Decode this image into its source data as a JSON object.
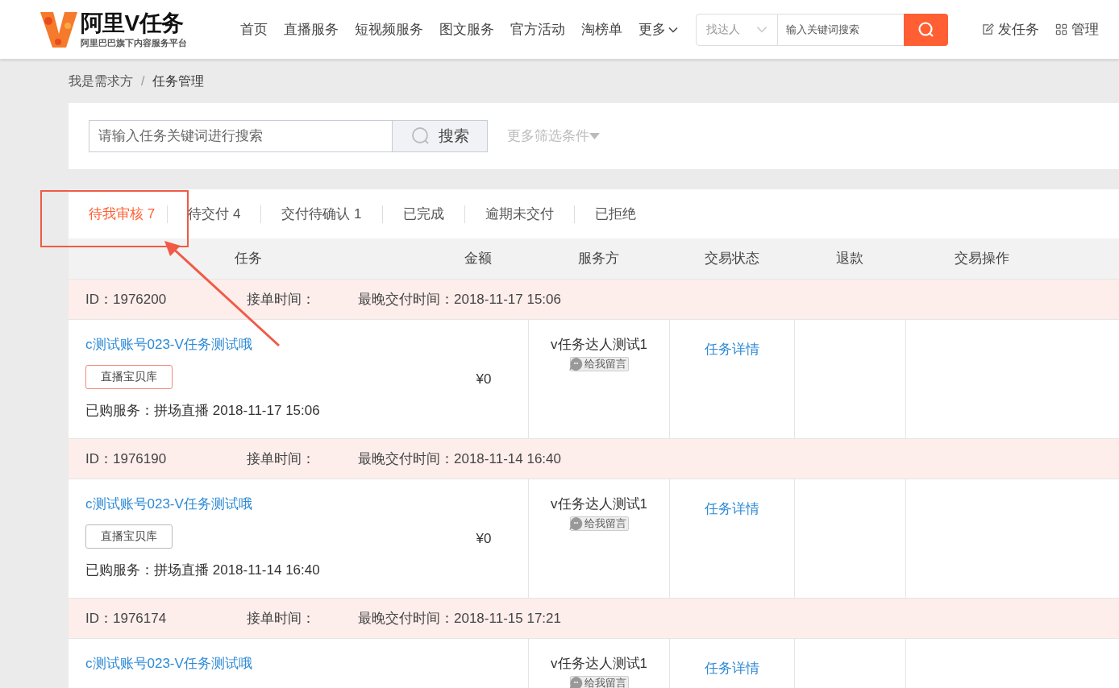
{
  "header": {
    "logo": {
      "title": "阿里V任务",
      "subtitle": "阿里巴巴旗下内容服务平台"
    },
    "nav": [
      {
        "label": "首页",
        "dropdown": false
      },
      {
        "label": "直播服务",
        "dropdown": false
      },
      {
        "label": "短视频服务",
        "dropdown": false
      },
      {
        "label": "图文服务",
        "dropdown": false
      },
      {
        "label": "官方活动",
        "dropdown": false
      },
      {
        "label": "淘榜单",
        "dropdown": false
      },
      {
        "label": "更多",
        "dropdown": true
      }
    ],
    "search": {
      "scope": "找达人",
      "placeholder": "输入关键词搜索"
    },
    "actions": [
      {
        "label": "发任务",
        "kind": "publish"
      },
      {
        "label": "管理",
        "kind": "manage"
      }
    ]
  },
  "breadcrumb": {
    "separator": "/",
    "items": [
      "我是需求方",
      "任务管理"
    ]
  },
  "filter": {
    "placeholder": "请输入任务关键词进行搜索",
    "button": "搜索",
    "more": "更多筛选条件"
  },
  "tabs": [
    {
      "label": "待我审核 7",
      "selected": true
    },
    {
      "label": "待交付 4",
      "selected": false
    },
    {
      "label": "交付待确认 1",
      "selected": false
    },
    {
      "label": "已完成",
      "selected": false
    },
    {
      "label": "逾期未交付",
      "selected": false
    },
    {
      "label": "已拒绝",
      "selected": false
    }
  ],
  "table": {
    "columns": [
      "任务",
      "金额",
      "服务方",
      "交易状态",
      "退款",
      "交易操作"
    ],
    "orders": [
      {
        "id": "ID：1976200",
        "accept_time": "接单时间：",
        "deadline": "最晚交付时间：2018-11-17 15:06",
        "title": "c测试账号023-V任务测试哦",
        "tag": {
          "label": "直播宝贝库",
          "highlighted": true
        },
        "purchased": "已购服务：拼场直播 2018-11-17 15:06",
        "amount": "¥0",
        "provider": "v任务达人测试1",
        "message": "给我留言",
        "action": "任务详情"
      },
      {
        "id": "ID：1976190",
        "accept_time": "接单时间：",
        "deadline": "最晚交付时间：2018-11-14 16:40",
        "title": "c测试账号023-V任务测试哦",
        "tag": {
          "label": "直播宝贝库",
          "highlighted": false
        },
        "purchased": "已购服务：拼场直播 2018-11-14 16:40",
        "amount": "¥0",
        "provider": "v任务达人测试1",
        "message": "给我留言",
        "action": "任务详情"
      },
      {
        "id": "ID：1976174",
        "accept_time": "接单时间：",
        "deadline": "最晚交付时间：2018-11-15 17:21",
        "title": "c测试账号023-V任务测试哦",
        "provider": "v任务达人测试1",
        "message": "给我留言",
        "action": "任务详情"
      }
    ]
  },
  "annotation": {
    "kind": "box-arrow"
  }
}
